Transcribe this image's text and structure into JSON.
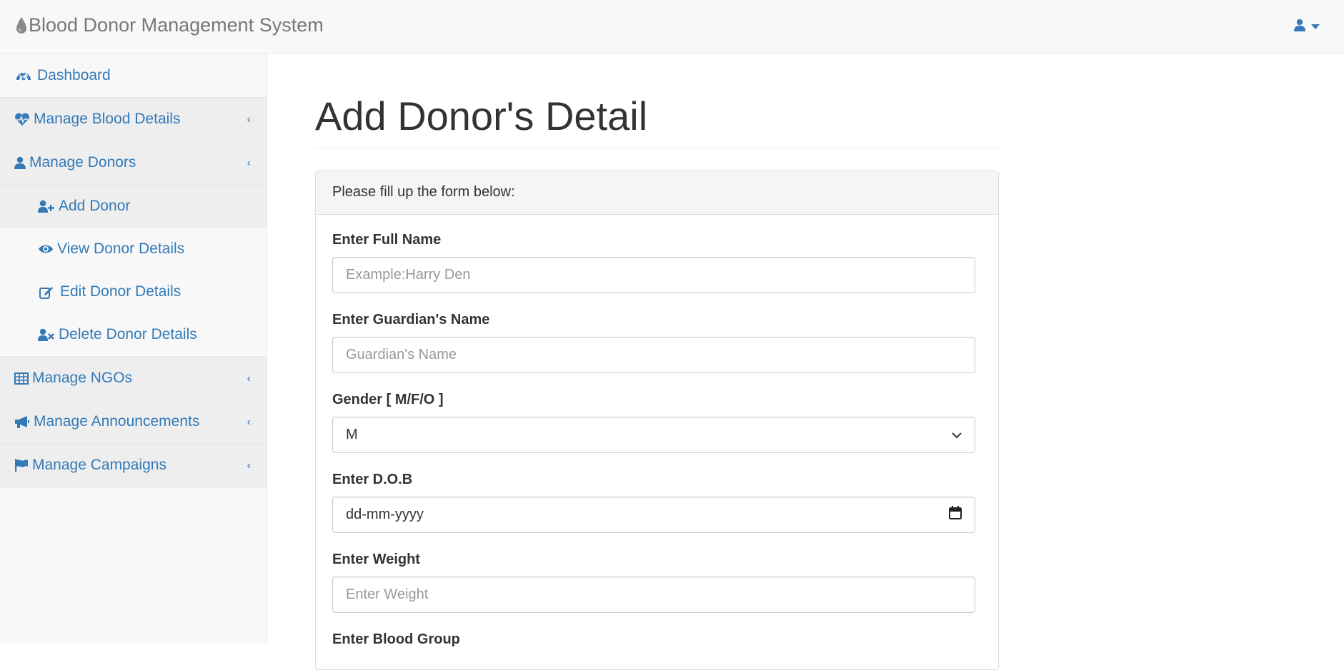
{
  "header": {
    "title": "Blood Donor Management System",
    "user_icon": "user-icon",
    "caret_icon": "caret-down-icon"
  },
  "sidebar": {
    "items": [
      {
        "label": "Dashboard",
        "icon": "dashboard-icon"
      },
      {
        "label": "Manage Blood Details",
        "icon": "heartbeat-icon"
      },
      {
        "label": "Manage Donors",
        "icon": "user-icon"
      },
      {
        "label": "Manage NGOs",
        "icon": "table-icon"
      },
      {
        "label": "Manage Announcements",
        "icon": "bullhorn-icon"
      },
      {
        "label": "Manage Campaigns",
        "icon": "flag-icon"
      }
    ],
    "donor_sub": [
      {
        "label": "Add Donor",
        "icon": "user-plus-icon"
      },
      {
        "label": "View Donor Details",
        "icon": "eye-icon"
      },
      {
        "label": "Edit Donor Details",
        "icon": "edit-icon"
      },
      {
        "label": "Delete Donor Details",
        "icon": "user-times-icon"
      }
    ]
  },
  "main": {
    "title": "Add Donor's Detail",
    "panel_heading": "Please fill up the form below:",
    "fields": {
      "full_name": {
        "label": "Enter Full Name",
        "placeholder": "Example:Harry Den"
      },
      "guardian": {
        "label": "Enter Guardian's Name",
        "placeholder": "Guardian's Name"
      },
      "gender": {
        "label": "Gender [ M/F/O ]",
        "value": "M"
      },
      "dob": {
        "label": "Enter D.O.B",
        "value": "dd-mm-yyyy"
      },
      "weight": {
        "label": "Enter Weight",
        "placeholder": "Enter Weight"
      },
      "blood_group": {
        "label": "Enter Blood Group"
      }
    }
  },
  "colors": {
    "link": "#337ab7",
    "brand": "#777777"
  }
}
